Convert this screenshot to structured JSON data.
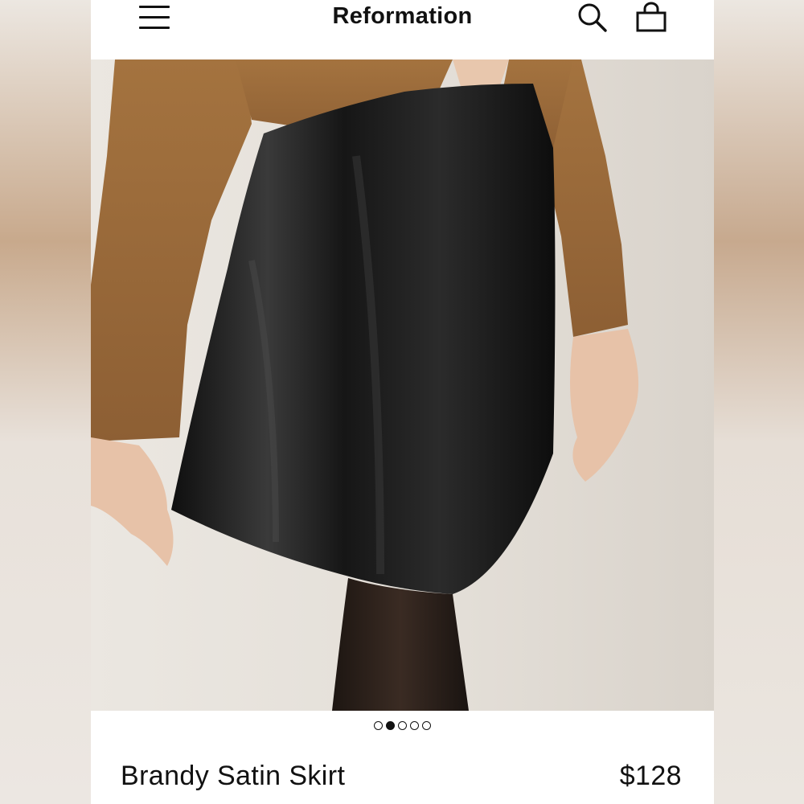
{
  "header": {
    "brand": "Reformation",
    "menu_icon": "hamburger-menu-icon",
    "search_icon": "search-icon",
    "bag_icon": "shopping-bag-icon"
  },
  "product": {
    "name": "Brandy Satin Skirt",
    "price": "$128",
    "image_alt": "Model wearing a black satin mini skirt and camel cardigan"
  },
  "carousel": {
    "count": 5,
    "active_index": 1
  },
  "colors": {
    "text": "#111111",
    "background": "#ffffff",
    "skirt": "#141414",
    "cardigan": "#a0703f"
  }
}
